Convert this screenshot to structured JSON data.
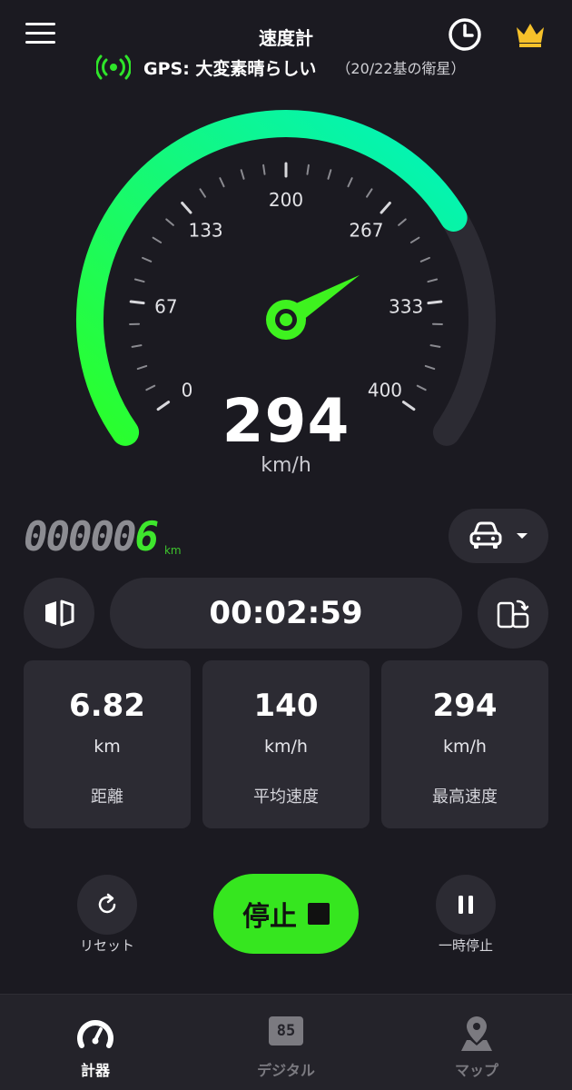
{
  "header": {
    "title": "速度計",
    "gps_status": "GPS: 大変素晴らしい",
    "gps_satellites": "（20/22基の衛星）"
  },
  "gauge": {
    "value": 294,
    "max": 400,
    "tick_labels": [
      "0",
      "67",
      "133",
      "200",
      "267",
      "333",
      "400"
    ],
    "speed_text": "294",
    "unit": "km/h",
    "colors": {
      "start": "#2bff2a",
      "end": "#00f2c0",
      "track": "#2c2b33",
      "needle": "#3ef21f"
    }
  },
  "odometer": {
    "leading_digits": "00000",
    "last_digit": "6",
    "unit": "km"
  },
  "timer": {
    "value": "00:02:59"
  },
  "stats": [
    {
      "value": "6.82",
      "unit": "km",
      "label": "距離"
    },
    {
      "value": "140",
      "unit": "km/h",
      "label": "平均速度"
    },
    {
      "value": "294",
      "unit": "km/h",
      "label": "最高速度"
    }
  ],
  "actions": {
    "reset_label": "リセット",
    "stop_label": "停止",
    "pause_label": "一時停止"
  },
  "nav": [
    {
      "label": "計器",
      "active": true
    },
    {
      "label": "デジタル",
      "active": false,
      "icon_text": "85"
    },
    {
      "label": "マップ",
      "active": false
    }
  ],
  "colors": {
    "background": "#1b1a21",
    "surface": "#2c2b33",
    "accent": "#36e61f",
    "inactive": "#7b7a80"
  }
}
